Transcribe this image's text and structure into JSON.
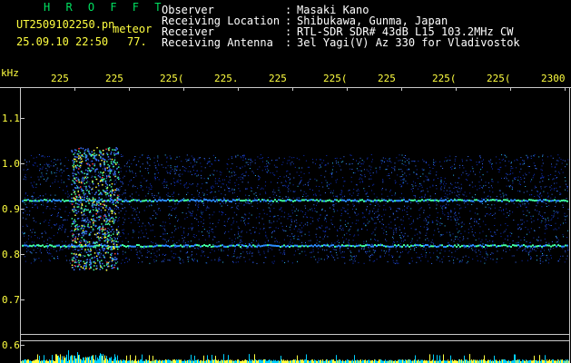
{
  "header": {
    "app_title": "H R O F F T",
    "filename": "UT2509102250.pn",
    "tag": "meteor",
    "datetime": "25.09.10 22:50",
    "count": "77.",
    "fields": [
      {
        "label": "Observer",
        "sep": ":",
        "value": "Masaki Kano"
      },
      {
        "label": "Receiving Location",
        "sep": ":",
        "value": "Shibukawa, Gunma, Japan"
      },
      {
        "label": "Receiver",
        "sep": ":",
        "value": "RTL-SDR SDR# 43dB L15 103.2MHz CW"
      },
      {
        "label": "Receiving Antenna",
        "sep": ":",
        "value": "3el Yagi(V) Az 330 for Vladivostok"
      }
    ]
  },
  "time_axis": {
    "ticks": [
      "225",
      "225",
      "225(",
      "225.",
      "225",
      "225(",
      "225",
      "225(",
      "225(",
      "2300"
    ]
  },
  "freq_axis": {
    "unit": "kHz",
    "labels": [
      "1.1",
      "1.0",
      "0.9",
      "0.8",
      "0.7",
      "0.6"
    ]
  },
  "signals": [
    {
      "name": "carrier-0.92",
      "freq_khz": 0.92
    },
    {
      "name": "carrier-0.82",
      "freq_khz": 0.82
    },
    {
      "name": "noise-band",
      "freq_khz_range": [
        0.78,
        1.02
      ]
    }
  ],
  "colors": {
    "background": "#000000",
    "title": "#00e060",
    "label": "#ffff40",
    "text": "#ffffff",
    "noise": "#1a50ff",
    "signal": "#40ffa0"
  }
}
